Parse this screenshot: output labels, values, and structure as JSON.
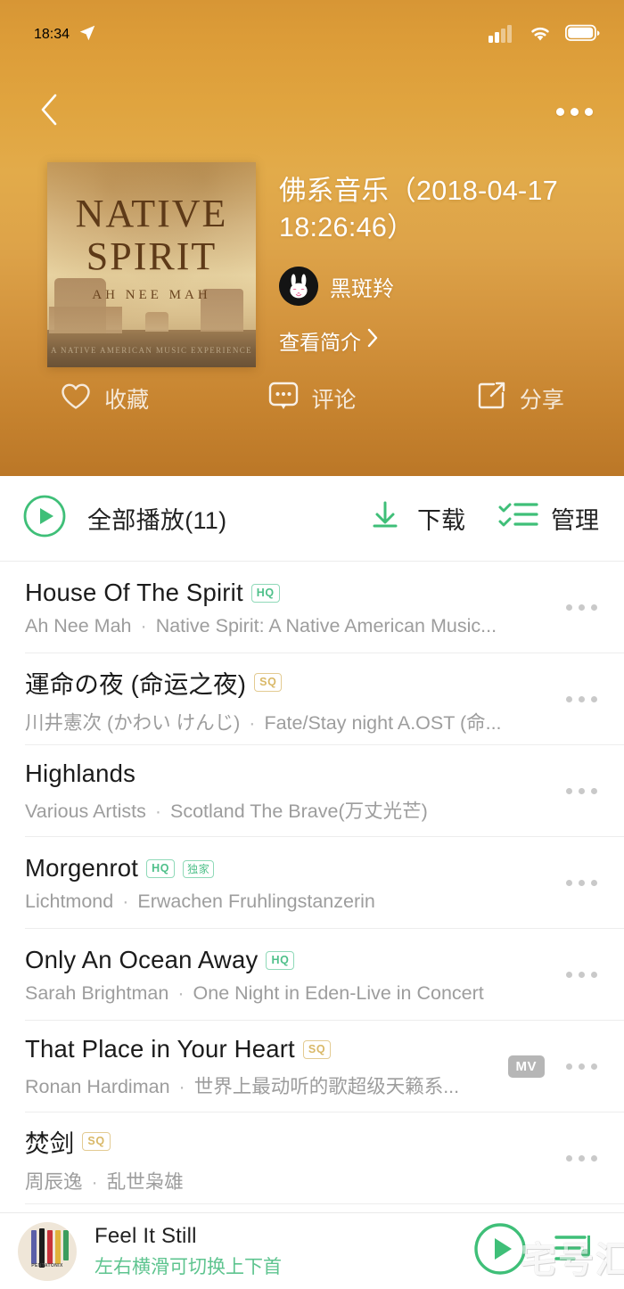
{
  "status_bar": {
    "time": "18:34",
    "location_icon": "location-arrow-icon",
    "cellular_icon": "cellular-bars-icon",
    "wifi_icon": "wifi-icon",
    "battery_icon": "battery-icon"
  },
  "nav": {
    "back_icon": "chevron-left-icon",
    "more_icon": "more-horizontal-icon"
  },
  "album": {
    "title": "佛系音乐（2018-04-17 18:26:46）",
    "creator_name": "黑斑羚",
    "avatar_icon": "dva-bunny-avatar",
    "intro_label": "查看简介",
    "intro_chevron": "chevron-right-icon",
    "cover": {
      "line1": "NATIVE",
      "line2": "SPIRIT",
      "subtitle": "AH NEE MAH",
      "footer": "A NATIVE AMERICAN MUSIC EXPERIENCE"
    }
  },
  "actions": [
    {
      "label": "收藏",
      "icon": "heart-outline-icon"
    },
    {
      "label": "评论",
      "icon": "comment-bubble-icon"
    },
    {
      "label": "分享",
      "icon": "share-arrow-icon"
    }
  ],
  "toolbar": {
    "play_all_label": "全部播放(11)",
    "play_all_icon": "play-circle-icon",
    "download_label": "下载",
    "download_icon": "download-icon",
    "manage_label": "管理",
    "manage_icon": "checklist-icon"
  },
  "tracks": [
    {
      "title": "House Of The Spirit",
      "artist": "Ah Nee Mah",
      "album": "Native Spirit: A Native American Music...",
      "badges": [
        "HQ"
      ],
      "mv": false
    },
    {
      "title": "運命の夜 (命运之夜)",
      "artist": "川井憲次 (かわい けんじ)",
      "album": "Fate/Stay night A.OST (命...",
      "badges": [
        "SQ"
      ],
      "mv": false
    },
    {
      "title": "Highlands",
      "artist": "Various Artists",
      "album": "Scotland The Brave(万丈光芒)",
      "badges": [],
      "mv": false
    },
    {
      "title": "Morgenrot",
      "artist": "Lichtmond",
      "album": "Erwachen Fruhlingstanzerin",
      "badges": [
        "HQ",
        "独家"
      ],
      "mv": false
    },
    {
      "title": "Only An Ocean Away",
      "artist": "Sarah Brightman",
      "album": "One Night in Eden-Live in Concert",
      "badges": [
        "HQ"
      ],
      "mv": false
    },
    {
      "title": "That Place in Your Heart",
      "artist": "Ronan Hardiman",
      "album": "世界上最动听的歌超级天籁系...",
      "badges": [
        "SQ"
      ],
      "mv": true,
      "mv_label": "MV"
    },
    {
      "title": "焚剑",
      "artist": "周辰逸",
      "album": "乱世枭雄",
      "badges": [
        "SQ"
      ],
      "mv": false
    }
  ],
  "mini_player": {
    "title": "Feel It Still",
    "hint": "左右横滑可切换上下首",
    "cover_caption": "PENTATONIX",
    "play_icon": "play-circle-icon",
    "playlist_icon": "playlist-icon",
    "watermark": "宅号汇"
  },
  "colors": {
    "accent_green": "#3fbf78",
    "header_top": "#d79635",
    "header_bottom": "#bb7727",
    "hq_badge": "#4fc08a",
    "sq_badge": "#d9b867",
    "mv_badge": "#b6b6b6"
  }
}
